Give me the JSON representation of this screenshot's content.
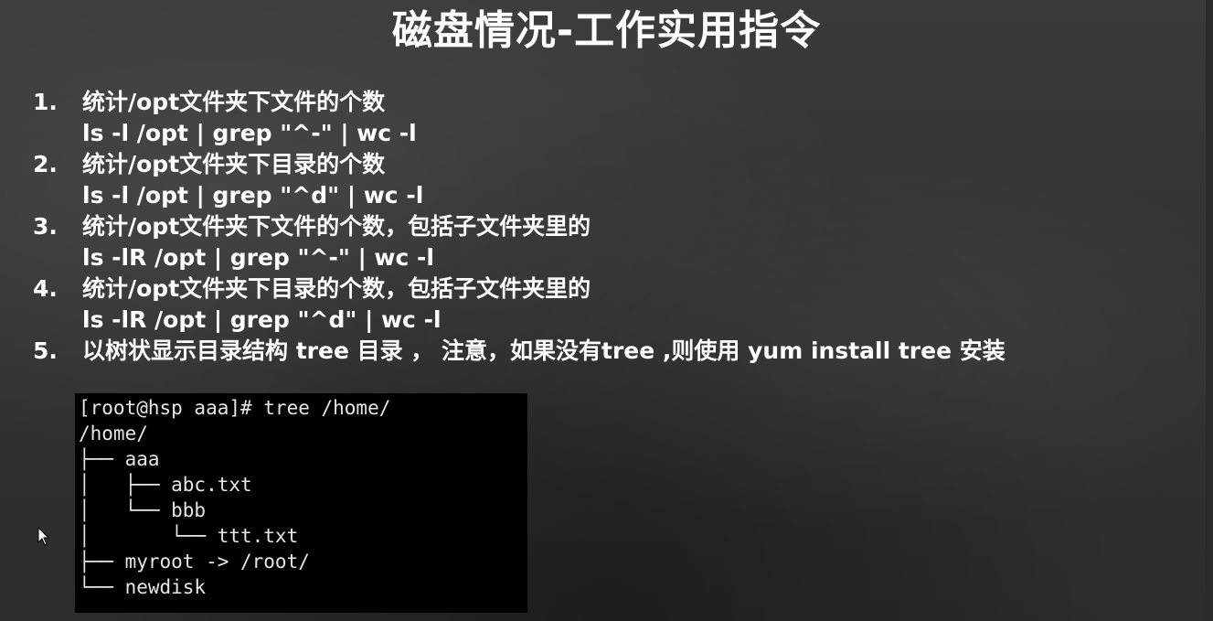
{
  "title": "磁盘情况-工作实用指令",
  "items": [
    {
      "num": "1.",
      "desc": "统计/opt文件夹下文件的个数",
      "cmd": "ls -l /opt | grep \"^-\" | wc -l"
    },
    {
      "num": "2.",
      "desc": "统计/opt文件夹下目录的个数",
      "cmd": "ls -l /opt | grep \"^d\" | wc -l"
    },
    {
      "num": "3.",
      "desc": "统计/opt文件夹下文件的个数，包括子文件夹里的",
      "cmd": "ls -lR /opt | grep \"^-\" | wc -l"
    },
    {
      "num": "4.",
      "desc": "统计/opt文件夹下目录的个数，包括子文件夹里的",
      "cmd": "ls -lR /opt | grep \"^d\" | wc -l"
    },
    {
      "num": "5.",
      "desc": "以树状显示目录结构 tree 目录 ， 注意，如果没有tree ,则使用 yum install tree 安装"
    }
  ],
  "terminal": {
    "lines": [
      "[root@hsp aaa]# tree /home/",
      "/home/",
      "├── aaa",
      "│   ├── abc.txt",
      "│   └── bbb",
      "│       └── ttt.txt",
      "├── myroot -> /root/",
      "└── newdisk"
    ]
  },
  "colors": {
    "background": "#333333",
    "text": "#ffffff",
    "terminal_bg": "#000000",
    "terminal_text": "#e6e6e6"
  },
  "icons": {
    "cursor": "mouse-pointer-icon"
  }
}
